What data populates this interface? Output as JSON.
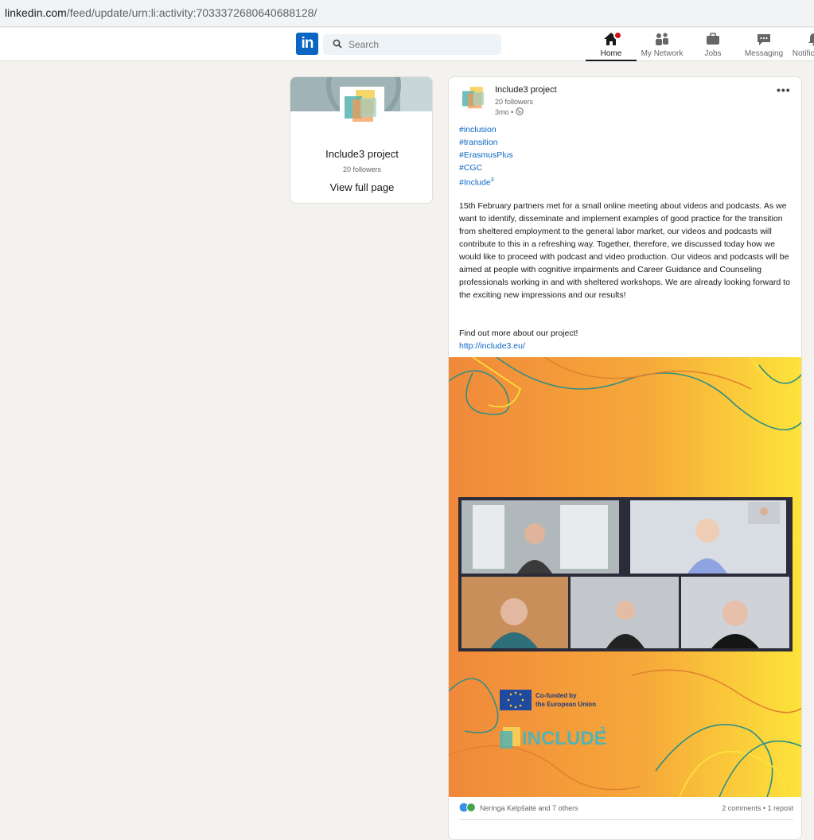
{
  "browser": {
    "url_domain": "linkedin.com",
    "url_path": "/feed/update/urn:li:activity:7033372680640688128/"
  },
  "nav": {
    "search_placeholder": "Search",
    "items": [
      {
        "label": "Home",
        "icon": "home-icon",
        "active": true
      },
      {
        "label": "My Network",
        "icon": "network-icon"
      },
      {
        "label": "Jobs",
        "icon": "briefcase-icon"
      },
      {
        "label": "Messaging",
        "icon": "messaging-icon"
      },
      {
        "label": "Notifications",
        "icon": "bell-icon"
      }
    ],
    "brand_color": "#0a66c2"
  },
  "company_card": {
    "name": "Include3 project",
    "followers": "20 followers",
    "view_label": "View full page"
  },
  "post": {
    "author": "Include3 project",
    "followers": "20 followers",
    "time": "3mo •",
    "hashtags": [
      "#inclusion",
      "#transition",
      "#ErasmusPlus",
      "#CGC",
      "#Include"
    ],
    "last_tag_sup": "3",
    "body": "15th February partners met for a small online meeting about videos and podcasts. As we want to identify, disseminate and implement examples of good practice for the transition from sheltered employment to the general labor market, our videos and podcasts will contribute to this in a refreshing way. Together, therefore, we discussed today how we would like to proceed with podcast and video production. Our videos and podcasts will be aimed at people with cognitive impairments and Career Guidance and Counseling professionals working in and with sheltered workshops. We are already looking forward to the exciting new impressions and our results!",
    "cta": "Find out more about our project!",
    "link": "http://include3.eu/",
    "image": {
      "eu_line1": "Co-funded by",
      "eu_line2": "the European Union",
      "brand": "INCLUDE",
      "brand_sup": "3"
    },
    "reactions": "Neringa Kelpšaitė and 7 others",
    "comments": "2 comments • 1 repost"
  }
}
